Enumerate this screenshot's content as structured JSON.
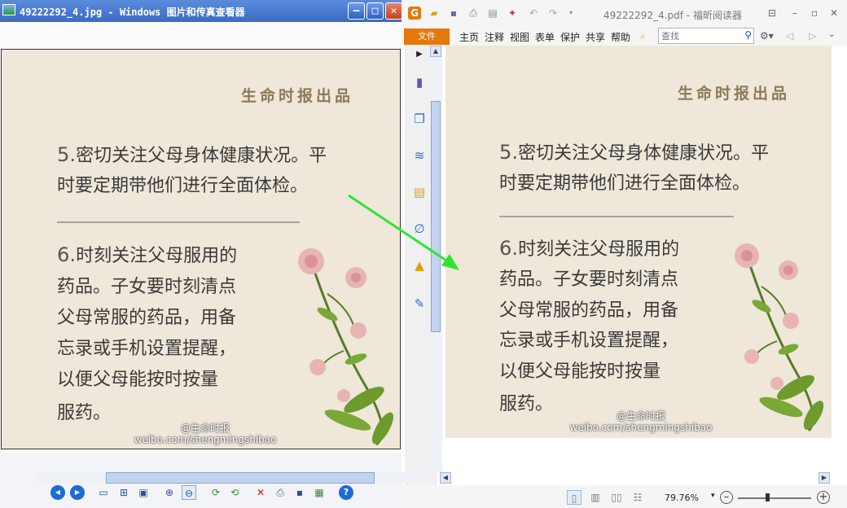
{
  "left_window": {
    "title": "49222292_4.jpg - Windows 图片和传真查看器",
    "title_icon": "image-file-icon",
    "buttons": {
      "minimize": "‒",
      "maximize": "□",
      "close": "✕"
    },
    "toolbar": {
      "prev": "◀",
      "next": "▶",
      "best_fit": "▭",
      "actual_size": "⊞",
      "slideshow": "▣",
      "zoom_in": "⊕",
      "zoom_out": "⊖",
      "rotate_cw": "⟳",
      "rotate_ccw": "⟲",
      "delete": "✕",
      "print": "⎙",
      "save": "▪",
      "open": "▦",
      "help": "?"
    }
  },
  "image_content": {
    "header": "生命时报出品",
    "point5_num": "5.",
    "point5_line1": "密切关注父母身体健康状况。平",
    "point5_line2": "时要定期带他们进行全面体检。",
    "point6_num": "6.",
    "point6_lines": [
      "时刻关注父母服用的",
      "药品。子女要时刻清点",
      "父母常服的药品，用备",
      "忘录或手机设置提醒，",
      "以便父母能按时按量",
      "服药。"
    ],
    "credit_line1": "@生命时报",
    "credit_line2": "weibo.com/shengmingshibao"
  },
  "right_window": {
    "title": "49222292_4.pdf - 福昕阅读器",
    "quick_access": [
      "foxit-logo-icon",
      "open-folder-icon",
      "save-icon",
      "print-icon",
      "scan-icon",
      "pdf-create-icon",
      "undo-icon",
      "redo-icon",
      "dropdown-icon"
    ],
    "menu": [
      "文件",
      "主页",
      "注释",
      "视图",
      "表单",
      "保护",
      "共享",
      "帮助"
    ],
    "search_placeholder": "查找",
    "sidebar_icons": [
      "expand-arrow-icon",
      "bookmark-icon",
      "pages-icon",
      "layers-icon",
      "comments-icon",
      "attachment-icon",
      "security-lock-icon",
      "signature-icon"
    ],
    "zoom": "79.76%",
    "zoom_dropdown": "▾"
  },
  "colors": {
    "accent": "#e5780b",
    "arrow": "#2ee62e",
    "page_bg": "#efe7d9"
  }
}
